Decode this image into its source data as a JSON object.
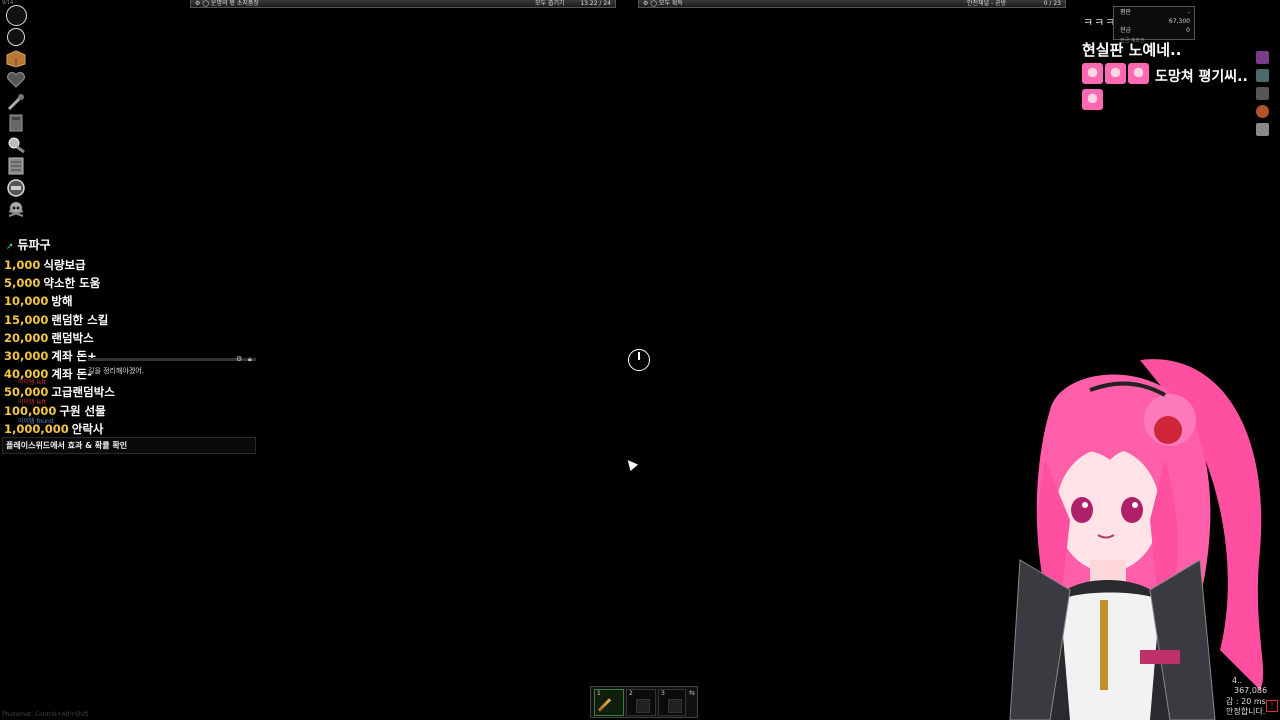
{
  "top_left_tiny": "9/14",
  "topbar_left": {
    "title": "운명의 몫 소지품창",
    "mid": "모두 줍기기",
    "right": "13.22 / 24"
  },
  "topbar_right": {
    "title": "모두 획득",
    "mid": "안전채널 - 공방",
    "right": "0 / 23"
  },
  "left_icons": [
    "circle-icon",
    "circle-icon",
    "crate-icon",
    "heart-icon",
    "wrench-icon",
    "book-icon",
    "magnifier-icon",
    "scroll-icon",
    "shield-badge-icon",
    "skull-icon"
  ],
  "donation": {
    "header": "듀파구",
    "items": [
      {
        "amount": "1,000",
        "label": "식량보급"
      },
      {
        "amount": "5,000",
        "label": "약소한 도움"
      },
      {
        "amount": "10,000",
        "label": "방해"
      },
      {
        "amount": "15,000",
        "label": "랜덤한 스킬"
      },
      {
        "amount": "20,000",
        "label": "랜덤박스"
      },
      {
        "amount": "30,000",
        "label": "계좌 돈+"
      },
      {
        "amount": "40,000",
        "label": "계좌 돈-"
      },
      {
        "amount": "50,000",
        "label": "고급랜덤박스"
      },
      {
        "amount": "100,000",
        "label": "구원 선물"
      },
      {
        "amount": "1,000,000",
        "label": "안락사"
      }
    ],
    "footer": "플레이스위드에서 효과 & 확률 확인"
  },
  "chat": {
    "message": "길을 정리해야겠어.",
    "red1": "아이템 left",
    "red2": "아이템 left",
    "blue1": "아이템 found"
  },
  "stats": {
    "rows": [
      {
        "label": "평판",
        "value": "-"
      },
      {
        "label": "",
        "value": "67,300"
      },
      {
        "label": "현금",
        "value": "0"
      }
    ],
    "sub": "현금 계좌진",
    "prefix_text": "ㅋㅋㅋㅋㅋㅋ"
  },
  "right_panel": {
    "title": "현실판 노예네..",
    "name": "도망쳐 평기씨.."
  },
  "hotbar": {
    "slots": [
      {
        "num": "1",
        "item": "sword-icon"
      },
      {
        "num": "2",
        "item": "cube-icon"
      },
      {
        "num": "3",
        "item": "cube-icon"
      }
    ]
  },
  "bottom_right": {
    "line1": "4..",
    "line2": "367,086",
    "line3": "갑 : 20 ms",
    "line4": "안정합니다."
  },
  "bottom_left_tiny": "Photomat: Control+Alt+Shift",
  "colors": {
    "amount": "#f2c744",
    "accent_arrow": "#48e0a8",
    "avatar_hair": "#ff5fa8"
  }
}
